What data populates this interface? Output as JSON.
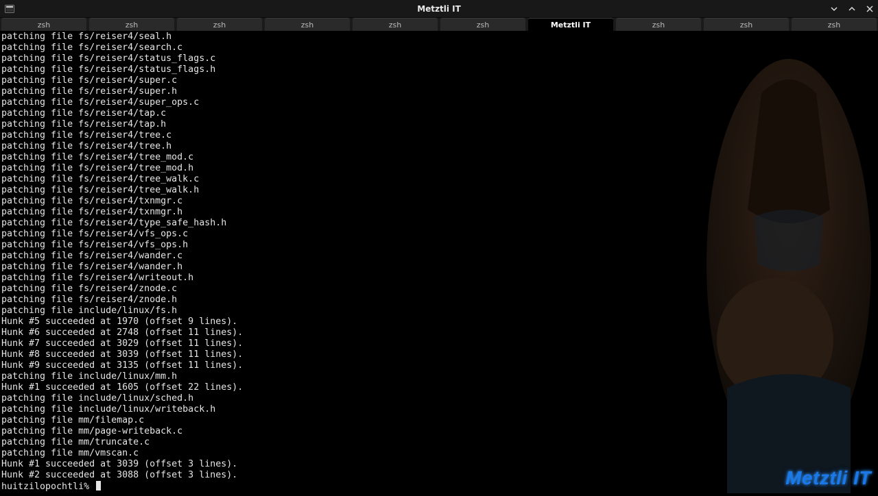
{
  "window": {
    "title": "Metztli IT"
  },
  "tabs": [
    {
      "label": "zsh",
      "active": false
    },
    {
      "label": "zsh",
      "active": false
    },
    {
      "label": "zsh",
      "active": false
    },
    {
      "label": "zsh",
      "active": false
    },
    {
      "label": "zsh",
      "active": false
    },
    {
      "label": "zsh",
      "active": false
    },
    {
      "label": "Metztli IT",
      "active": true
    },
    {
      "label": "zsh",
      "active": false
    },
    {
      "label": "zsh",
      "active": false
    },
    {
      "label": "zsh",
      "active": false
    }
  ],
  "terminal": {
    "lines": [
      "patching file fs/reiser4/seal.h",
      "patching file fs/reiser4/search.c",
      "patching file fs/reiser4/status_flags.c",
      "patching file fs/reiser4/status_flags.h",
      "patching file fs/reiser4/super.c",
      "patching file fs/reiser4/super.h",
      "patching file fs/reiser4/super_ops.c",
      "patching file fs/reiser4/tap.c",
      "patching file fs/reiser4/tap.h",
      "patching file fs/reiser4/tree.c",
      "patching file fs/reiser4/tree.h",
      "patching file fs/reiser4/tree_mod.c",
      "patching file fs/reiser4/tree_mod.h",
      "patching file fs/reiser4/tree_walk.c",
      "patching file fs/reiser4/tree_walk.h",
      "patching file fs/reiser4/txnmgr.c",
      "patching file fs/reiser4/txnmgr.h",
      "patching file fs/reiser4/type_safe_hash.h",
      "patching file fs/reiser4/vfs_ops.c",
      "patching file fs/reiser4/vfs_ops.h",
      "patching file fs/reiser4/wander.c",
      "patching file fs/reiser4/wander.h",
      "patching file fs/reiser4/writeout.h",
      "patching file fs/reiser4/znode.c",
      "patching file fs/reiser4/znode.h",
      "patching file include/linux/fs.h",
      "Hunk #5 succeeded at 1970 (offset 9 lines).",
      "Hunk #6 succeeded at 2748 (offset 11 lines).",
      "Hunk #7 succeeded at 3029 (offset 11 lines).",
      "Hunk #8 succeeded at 3039 (offset 11 lines).",
      "Hunk #9 succeeded at 3135 (offset 11 lines).",
      "patching file include/linux/mm.h",
      "Hunk #1 succeeded at 1605 (offset 22 lines).",
      "patching file include/linux/sched.h",
      "patching file include/linux/writeback.h",
      "patching file mm/filemap.c",
      "patching file mm/page-writeback.c",
      "patching file mm/truncate.c",
      "patching file mm/vmscan.c",
      "Hunk #1 succeeded at 3039 (offset 3 lines).",
      "Hunk #2 succeeded at 3088 (offset 3 lines)."
    ],
    "prompt": "huitzilopochtli% "
  },
  "watermark": {
    "text": "Metztli IT"
  }
}
